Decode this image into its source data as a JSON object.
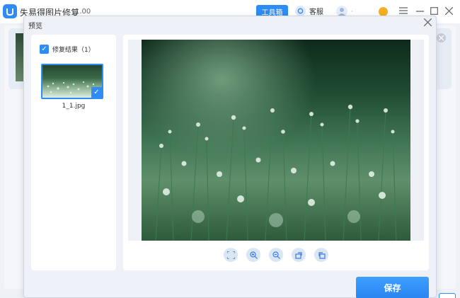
{
  "app": {
    "title": "失易得图片修复",
    "version": "1.00"
  },
  "titlebar": {
    "toolbox_label": "工具箱",
    "support_label": "客服",
    "user_dot": "·"
  },
  "dialog": {
    "title": "预览",
    "results_label": "修复结果（1）",
    "files": [
      {
        "name": "1_1.jpg",
        "checked": true
      }
    ],
    "save_label": "保存"
  },
  "controls": [
    "fit-screen-icon",
    "zoom-in-icon",
    "zoom-out-icon",
    "rotate-icon",
    "restore-icon"
  ],
  "colors": {
    "accent": "#2f8cf5",
    "vip": "#f2b01e"
  }
}
